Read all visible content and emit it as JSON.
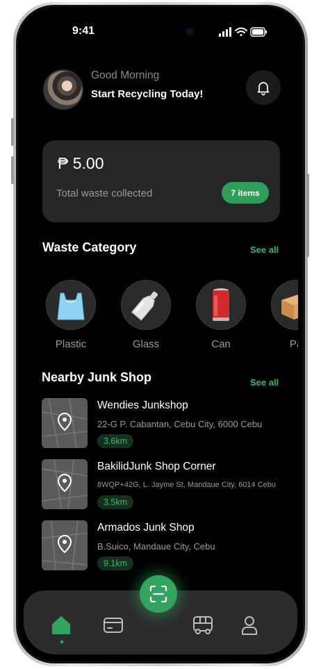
{
  "status_bar": {
    "time": "9:41"
  },
  "header": {
    "greeting": "Good Morning",
    "subtitle": "Start Recycling Today!"
  },
  "balance": {
    "amount": "₱ 5.00",
    "label": "Total waste collected",
    "items_badge": "7 items"
  },
  "waste_category": {
    "title": "Waste Category",
    "see_all": "See all",
    "items": [
      {
        "label": "Plastic",
        "icon": "plastic-bag-icon"
      },
      {
        "label": "Glass",
        "icon": "glass-bottle-icon"
      },
      {
        "label": "Can",
        "icon": "soda-can-icon"
      },
      {
        "label": "Pa",
        "icon": "paper-box-icon"
      }
    ]
  },
  "nearby": {
    "title": "Nearby Junk Shop",
    "see_all": "See all",
    "shops": [
      {
        "name": "Wendies Junkshop",
        "address": "22-G P. Cabantan, Cebu City, 6000 Cebu",
        "distance": "3.6km"
      },
      {
        "name": "BakilidJunk Shop Corner",
        "address": "8WQP+42G, L. Jayme St, Mandaue City, 6014 Cebu",
        "distance": "3.5km"
      },
      {
        "name": "Armados Junk Shop",
        "address": "B.Suico, Mandaue City, Cebu",
        "distance": "9.1km"
      }
    ]
  },
  "bottom_nav": {
    "items": [
      "home-icon",
      "wallet-icon",
      "scan-icon",
      "bus-icon",
      "profile-icon"
    ],
    "active": "home-icon"
  },
  "colors": {
    "accent": "#32a45f",
    "background": "#000000",
    "card": "#262626"
  }
}
